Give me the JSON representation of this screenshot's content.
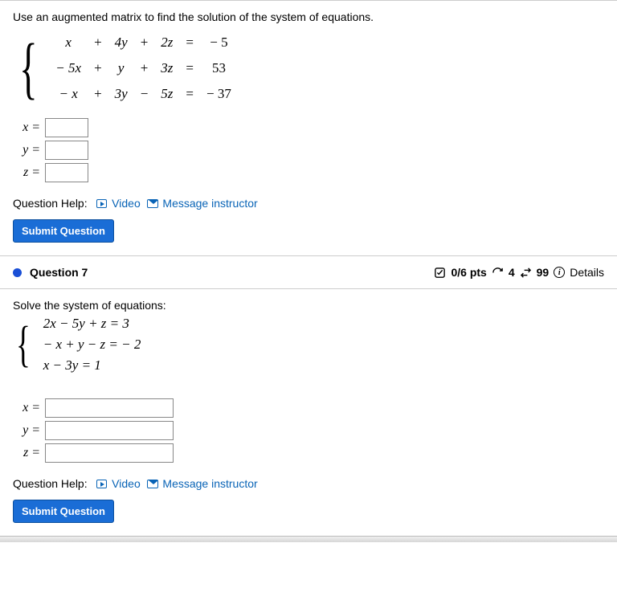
{
  "q6": {
    "prompt": "Use an augmented matrix to find the solution of the system of equations.",
    "grid": {
      "r1": {
        "c1": "x",
        "c2": "+",
        "c3": "4y",
        "c4": "+",
        "c5": "2z",
        "c6": "=",
        "c7": "− 5"
      },
      "r2": {
        "c1": "− 5x",
        "c2": "+",
        "c3": "y",
        "c4": "+",
        "c5": "3z",
        "c6": "=",
        "c7": "53"
      },
      "r3": {
        "c1": "− x",
        "c2": "+",
        "c3": "3y",
        "c4": "−",
        "c5": "5z",
        "c6": "=",
        "c7": "− 37"
      }
    },
    "answers": {
      "x_label": "x =",
      "y_label": "y =",
      "z_label": "z ="
    },
    "help_label": "Question Help:",
    "video": "Video",
    "message": "Message instructor",
    "submit": "Submit Question"
  },
  "q7": {
    "header": {
      "title": "Question 7",
      "score": "0/6 pts",
      "attempts": "4",
      "tries": "99",
      "details": "Details"
    },
    "prompt": "Solve the system of equations:",
    "eq1": "2x − 5y + z = 3",
    "eq2": "− x + y − z =  − 2",
    "eq3": "x − 3y = 1",
    "answers": {
      "x_label": "x =",
      "y_label": "y =",
      "z_label": "z ="
    },
    "help_label": "Question Help:",
    "video": "Video",
    "message": "Message instructor",
    "submit": "Submit Question"
  }
}
